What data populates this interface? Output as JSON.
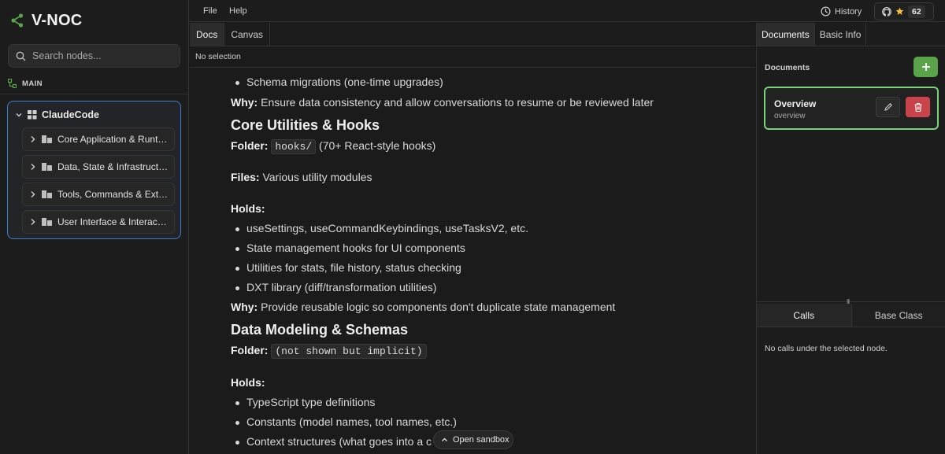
{
  "app": {
    "name": "V-NOC",
    "accent": "#5aa34b"
  },
  "sidebar": {
    "search_placeholder": "Search nodes...",
    "branch": "MAIN",
    "tree": {
      "root": "ClaudeCode",
      "items": [
        {
          "label": "Core Application & Runtime"
        },
        {
          "label": "Data, State & Infrastructure"
        },
        {
          "label": "Tools, Commands & Extensions"
        },
        {
          "label": "User Interface & Interaction"
        }
      ]
    }
  },
  "menu": {
    "file": "File",
    "help": "Help",
    "history": "History",
    "stars": "62"
  },
  "docs_panel": {
    "tabs": [
      {
        "label": "Docs",
        "active": true
      },
      {
        "label": "Canvas",
        "active": false
      }
    ],
    "selection": "No selection",
    "content": {
      "b0": "Schema migrations (one-time upgrades)",
      "why1_label": "Why:",
      "why1_text": " Ensure data consistency and allow conversations to resume or be reviewed later",
      "h_core": "Core Utilities & Hooks",
      "folder_label": "Folder:",
      "folder1_code": "hooks/",
      "folder1_text": " (70+ React-style hooks)",
      "files_label": "Files:",
      "files_text": " Various utility modules",
      "holds_label": "Holds:",
      "b1": "useSettings, useCommandKeybindings, useTasksV2, etc.",
      "b2": "State management hooks for UI components",
      "b3": "Utilities for stats, file history, status checking",
      "b4": "DXT library (diff/transformation utilities)",
      "why2_label": "Why:",
      "why2_text": " Provide reusable logic so components don't duplicate state management",
      "h_data": "Data Modeling & Schemas",
      "folder2_label": "Folder:",
      "folder2_code": "(not shown but implicit)",
      "holds2_label": "Holds:",
      "b5": "TypeScript type definitions",
      "b6": "Constants (model names, tool names, etc.)",
      "b7": "Context structures (what goes into a c"
    },
    "sandbox_button": "Open sandbox"
  },
  "right_panel": {
    "tabs": [
      {
        "label": "Documents",
        "active": true
      },
      {
        "label": "Basic Info",
        "active": false
      }
    ],
    "heading": "Documents",
    "doc": {
      "title": "Overview",
      "subtitle": "overview"
    },
    "bottom_tabs": [
      {
        "label": "Calls",
        "active": true
      },
      {
        "label": "Base Class",
        "active": false
      }
    ],
    "calls_message": "No calls under the selected node."
  },
  "colors": {
    "selection_border": "#3b7fd4",
    "doc_card_border": "#7ad37a",
    "delete": "#c9444a"
  }
}
